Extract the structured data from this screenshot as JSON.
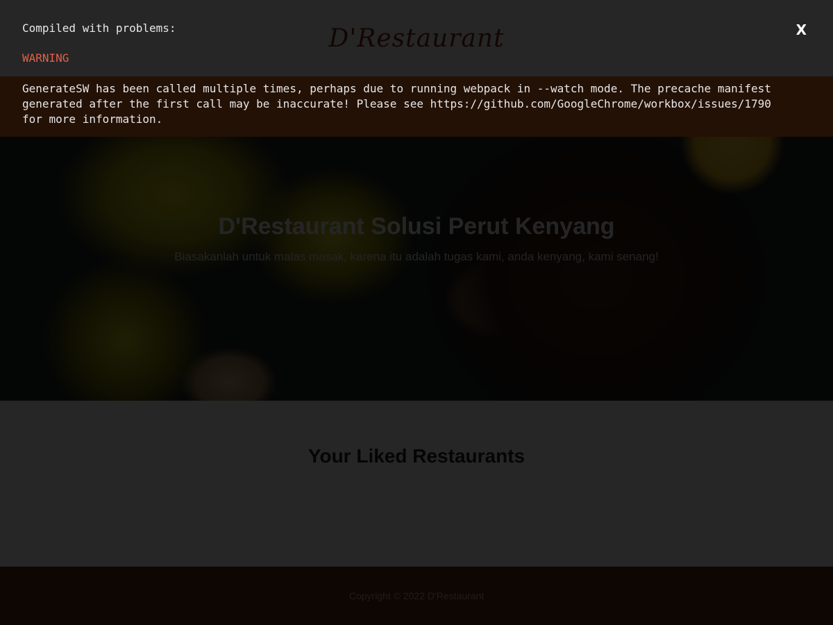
{
  "header": {
    "brand": "D'Restaurant"
  },
  "hero": {
    "title": "D'Restaurant Solusi Perut Kenyang",
    "subtitle": "Biasakanlah untuk malas masak, karena itu adalah tugas kami, anda kenyang, kami senang!"
  },
  "main": {
    "section_title": "Your Liked Restaurants"
  },
  "footer": {
    "copyright": "Copyright © 2022 D'Restaurant"
  },
  "overlay": {
    "heading": "Compiled with problems:",
    "close_label": "X",
    "warning_label": "WARNING",
    "message": "GenerateSW has been called multiple times, perhaps due to running webpack in --watch mode. The precache manifest\ngenerated after the first call may be inaccurate! Please see https://github.com/GoogleChrome/workbox/issues/1790\nfor more information."
  },
  "colors": {
    "overlay_dim": "#000000",
    "warning_text": "#e36049",
    "message_background": "#231106",
    "brand": "#7a2a14",
    "footer_background": "#5a2b14"
  }
}
